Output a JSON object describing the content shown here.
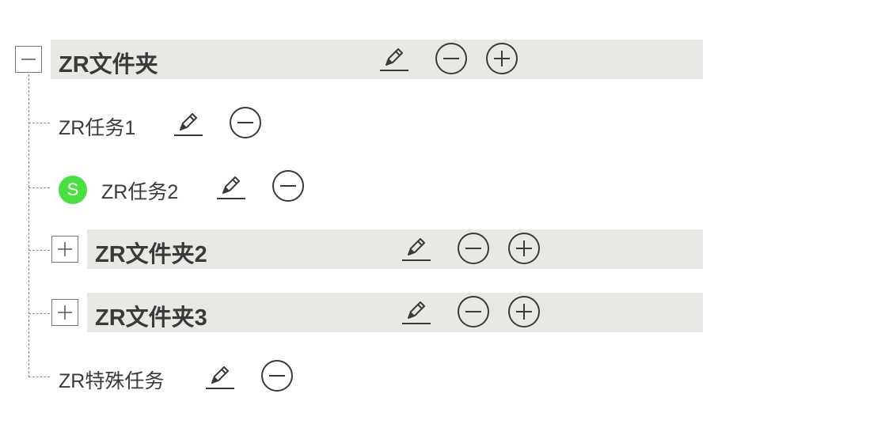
{
  "tree": {
    "root": {
      "label": "ZR文件夹",
      "expanded": true
    },
    "children": [
      {
        "type": "task",
        "label": "ZR任务1"
      },
      {
        "type": "task",
        "label": "ZR任务2",
        "badge": "S",
        "badge_color": "#4be041"
      },
      {
        "type": "folder",
        "label": "ZR文件夹2",
        "expanded": false
      },
      {
        "type": "folder",
        "label": "ZR文件夹3",
        "expanded": false
      },
      {
        "type": "task",
        "label": "ZR特殊任务"
      }
    ]
  },
  "icons": {
    "edit": "pencil-icon",
    "remove": "minus-circle-icon",
    "add": "plus-circle-icon",
    "collapse": "minus-square-icon",
    "expand": "plus-square-icon"
  },
  "colors": {
    "folder_band": "#e9e8e5",
    "text": "#3a3a3a",
    "badge": "#4be041"
  }
}
